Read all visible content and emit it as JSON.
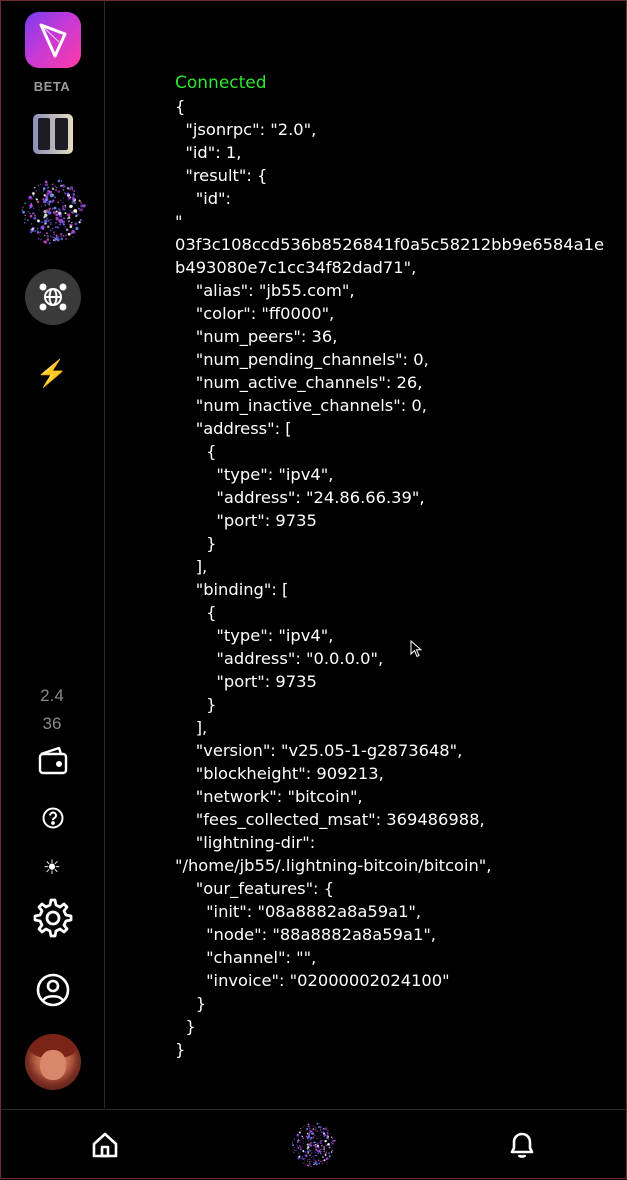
{
  "sidebar": {
    "beta_label": "BETA",
    "stats": [
      "2.4",
      "36"
    ],
    "icons": [
      "app-logo-icon",
      "columns-icon",
      "noise-blob-icon",
      "network-icon",
      "lightning-icon",
      "wallet-icon",
      "help-icon",
      "sun-icon",
      "gear-icon",
      "user-circle-icon",
      "avatar"
    ]
  },
  "main": {
    "status": "Connected",
    "status_color": "#2ee62e",
    "json_text": "{\n  \"jsonrpc\": \"2.0\",\n  \"id\": 1,\n  \"result\": {\n    \"id\":\n\"\n03f3c108ccd536b8526841f0a5c58212bb9e6584a1eb493080e7c1cc34f82dad71\",\n    \"alias\": \"jb55.com\",\n    \"color\": \"ff0000\",\n    \"num_peers\": 36,\n    \"num_pending_channels\": 0,\n    \"num_active_channels\": 26,\n    \"num_inactive_channels\": 0,\n    \"address\": [\n      {\n        \"type\": \"ipv4\",\n        \"address\": \"24.86.66.39\",\n        \"port\": 9735\n      }\n    ],\n    \"binding\": [\n      {\n        \"type\": \"ipv4\",\n        \"address\": \"0.0.0.0\",\n        \"port\": 9735\n      }\n    ],\n    \"version\": \"v25.05-1-g2873648\",\n    \"blockheight\": 909213,\n    \"network\": \"bitcoin\",\n    \"fees_collected_msat\": 369486988,\n    \"lightning-dir\":\n\"/home/jb55/.lightning-bitcoin/bitcoin\",\n    \"our_features\": {\n      \"init\": \"08a8882a8a59a1\",\n      \"node\": \"88a8882a8a59a1\",\n      \"channel\": \"\",\n      \"invoice\": \"02000002024100\"\n    }\n  }\n}"
  },
  "bottom_nav": {
    "icons": [
      "home-icon",
      "noise-blob-icon",
      "bell-icon"
    ]
  }
}
